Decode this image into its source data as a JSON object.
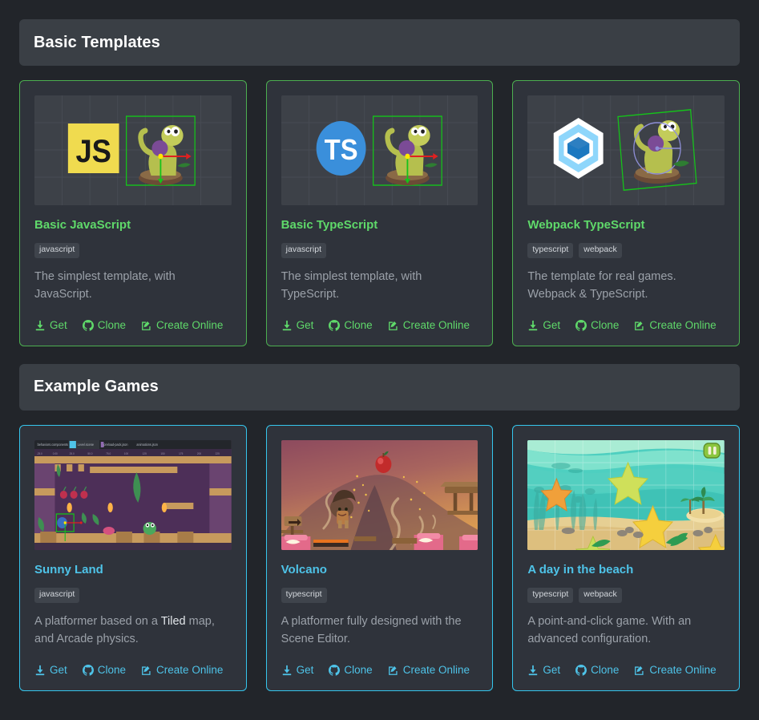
{
  "accent": {
    "templates": "#5fd96a",
    "games": "#4ec3e8"
  },
  "sections": [
    {
      "id": "basic-templates",
      "title": "Basic Templates",
      "accent": "green",
      "cards": [
        {
          "title": "Basic JavaScript",
          "tags": [
            "javascript"
          ],
          "desc_before": "The simplest template, with JavaScript.",
          "desc_strong": "",
          "desc_after": "",
          "thumb": "js-editor-thumbnail",
          "links": [
            {
              "label": "Get",
              "icon": "download-icon"
            },
            {
              "label": "Clone",
              "icon": "github-icon"
            },
            {
              "label": "Create Online",
              "icon": "pencil-square-icon"
            }
          ]
        },
        {
          "title": "Basic TypeScript",
          "tags": [
            "javascript"
          ],
          "desc_before": "The simplest template, with TypeScript.",
          "desc_strong": "",
          "desc_after": "",
          "thumb": "ts-editor-thumbnail",
          "links": [
            {
              "label": "Get",
              "icon": "download-icon"
            },
            {
              "label": "Clone",
              "icon": "github-icon"
            },
            {
              "label": "Create Online",
              "icon": "pencil-square-icon"
            }
          ]
        },
        {
          "title": "Webpack TypeScript",
          "tags": [
            "typescript",
            "webpack"
          ],
          "desc_before": "The template for real games. Webpack & TypeScript.",
          "desc_strong": "",
          "desc_after": "",
          "thumb": "webpack-editor-thumbnail",
          "links": [
            {
              "label": "Get",
              "icon": "download-icon"
            },
            {
              "label": "Clone",
              "icon": "github-icon"
            },
            {
              "label": "Create Online",
              "icon": "pencil-square-icon"
            }
          ]
        }
      ]
    },
    {
      "id": "example-games",
      "title": "Example Games",
      "accent": "cyan",
      "cards": [
        {
          "title": "Sunny Land",
          "tags": [
            "javascript"
          ],
          "desc_before": "A platformer based on a ",
          "desc_strong": "Tiled",
          "desc_after": " map, and Arcade physics.",
          "thumb": "sunny-land-thumbnail",
          "links": [
            {
              "label": "Get",
              "icon": "download-icon"
            },
            {
              "label": "Clone",
              "icon": "github-icon"
            },
            {
              "label": "Create Online",
              "icon": "pencil-square-icon"
            }
          ]
        },
        {
          "title": "Volcano",
          "tags": [
            "typescript"
          ],
          "desc_before": "A platformer fully designed with the Scene Editor.",
          "desc_strong": "",
          "desc_after": "",
          "thumb": "volcano-thumbnail",
          "links": [
            {
              "label": "Get",
              "icon": "download-icon"
            },
            {
              "label": "Clone",
              "icon": "github-icon"
            },
            {
              "label": "Create Online",
              "icon": "pencil-square-icon"
            }
          ]
        },
        {
          "title": "A day in the beach",
          "tags": [
            "typescript",
            "webpack"
          ],
          "desc_before": "A point-and-click game. With an advanced configuration.",
          "desc_strong": "",
          "desc_after": "",
          "thumb": "beach-thumbnail",
          "links": [
            {
              "label": "Get",
              "icon": "download-icon"
            },
            {
              "label": "Clone",
              "icon": "github-icon"
            },
            {
              "label": "Create Online",
              "icon": "pencil-square-icon"
            }
          ]
        }
      ]
    }
  ],
  "thumbnails": {
    "js-editor-thumbnail": {
      "logo_text": "JS",
      "sprite": "dino-character"
    },
    "ts-editor-thumbnail": {
      "logo_text": "TS",
      "sprite": "dino-character"
    },
    "webpack-editor-thumbnail": {
      "logo_text": "",
      "sprite": "dino-character"
    },
    "sunny-land-thumbnail": {
      "tabs": [
        "behaviors.components",
        "Level.scene",
        "preload-pack.json",
        "animations.json"
      ]
    },
    "volcano-thumbnail": {},
    "beach-thumbnail": {}
  }
}
